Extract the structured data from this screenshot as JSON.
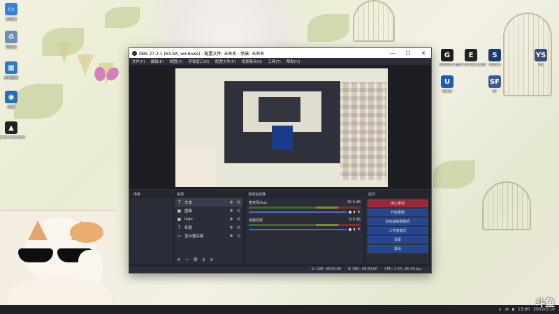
{
  "obs": {
    "title": "OBS 27.2.1 (64-bit, windows) - 配置文件: 未命名 - 场景: 未命名",
    "window_controls": {
      "minimize": "—",
      "maximize": "☐",
      "close": "✕"
    },
    "menu": [
      "文件(F)",
      "编辑(E)",
      "视图(V)",
      "停靠窗口(D)",
      "配置文件(P)",
      "场景集合(S)",
      "工具(T)",
      "帮助(H)"
    ],
    "docks": {
      "scenes_title": "场景",
      "sources_title": "来源",
      "mixer_title": "音频混音器",
      "controls_title": "控件"
    },
    "sources": [
      {
        "icon": "text-icon",
        "glyph": "T",
        "name": "文本"
      },
      {
        "icon": "image-icon",
        "glyph": "▣",
        "name": "图像"
      },
      {
        "icon": "image-icon",
        "glyph": "▣",
        "name": "logo"
      },
      {
        "icon": "text-icon",
        "glyph": "T",
        "name": "标题"
      },
      {
        "icon": "monitor-icon",
        "glyph": "▭",
        "name": "显示器采集"
      }
    ],
    "sources_footer": [
      "+",
      "−",
      "⚙",
      "∧",
      "∨"
    ],
    "mixer": [
      {
        "name": "麦克风/Aux",
        "level": "15.0 dB"
      },
      {
        "name": "桌面音频",
        "level": "6.0 dB"
      }
    ],
    "controls": {
      "stop_stream": "停止推流",
      "start_record": "开始录制",
      "virtual_cam": "启动虚拟摄像机",
      "studio_mode": "工作室模式",
      "settings": "设置",
      "exit": "退出"
    },
    "status": {
      "live": "LIVE: 00:00:00",
      "rec": "REC: 00:00:00",
      "cpu": "CPU: 1.0%, 60.00 fps"
    }
  },
  "desktop_icons_left": [
    {
      "name": "computer-icon",
      "label": "此电脑",
      "color": "#3d7fd6",
      "glyph": "▭"
    },
    {
      "name": "recycle-bin-icon",
      "label": "回收站",
      "color": "#6d8fb0",
      "glyph": "♻"
    },
    {
      "name": "control-panel-icon",
      "label": "控制面板",
      "color": "#2d79c7",
      "glyph": "▦"
    },
    {
      "name": "network-icon",
      "label": "网络",
      "color": "#2b6db5",
      "glyph": "◉"
    },
    {
      "name": "app-icon",
      "label": "perfectmachine",
      "color": "#222",
      "glyph": "▲"
    }
  ],
  "desktop_icons_right": [
    {
      "name": "wegame-icon",
      "label": "WeGame",
      "color": "#1d1d1d",
      "glyph": "G"
    },
    {
      "name": "epic-games-icon",
      "label": "Epic Games Launcher",
      "color": "#222",
      "glyph": "E"
    },
    {
      "name": "steam-icon",
      "label": "Steam",
      "color": "#1b3b6f",
      "glyph": "S"
    },
    {
      "name": "uplay-icon",
      "label": "Uplay",
      "color": "#1f5bb7",
      "glyph": "U"
    },
    {
      "name": "app-icon-sf",
      "label": "SF",
      "color": "#3d5a99",
      "glyph": "SF"
    },
    {
      "name": "app-icon-ys",
      "label": "YS",
      "color": "#3a4e7a",
      "glyph": "YS"
    }
  ],
  "taskbar": {
    "time": "13:00",
    "date": "2022/2/10"
  },
  "watermark": "斗鱼"
}
